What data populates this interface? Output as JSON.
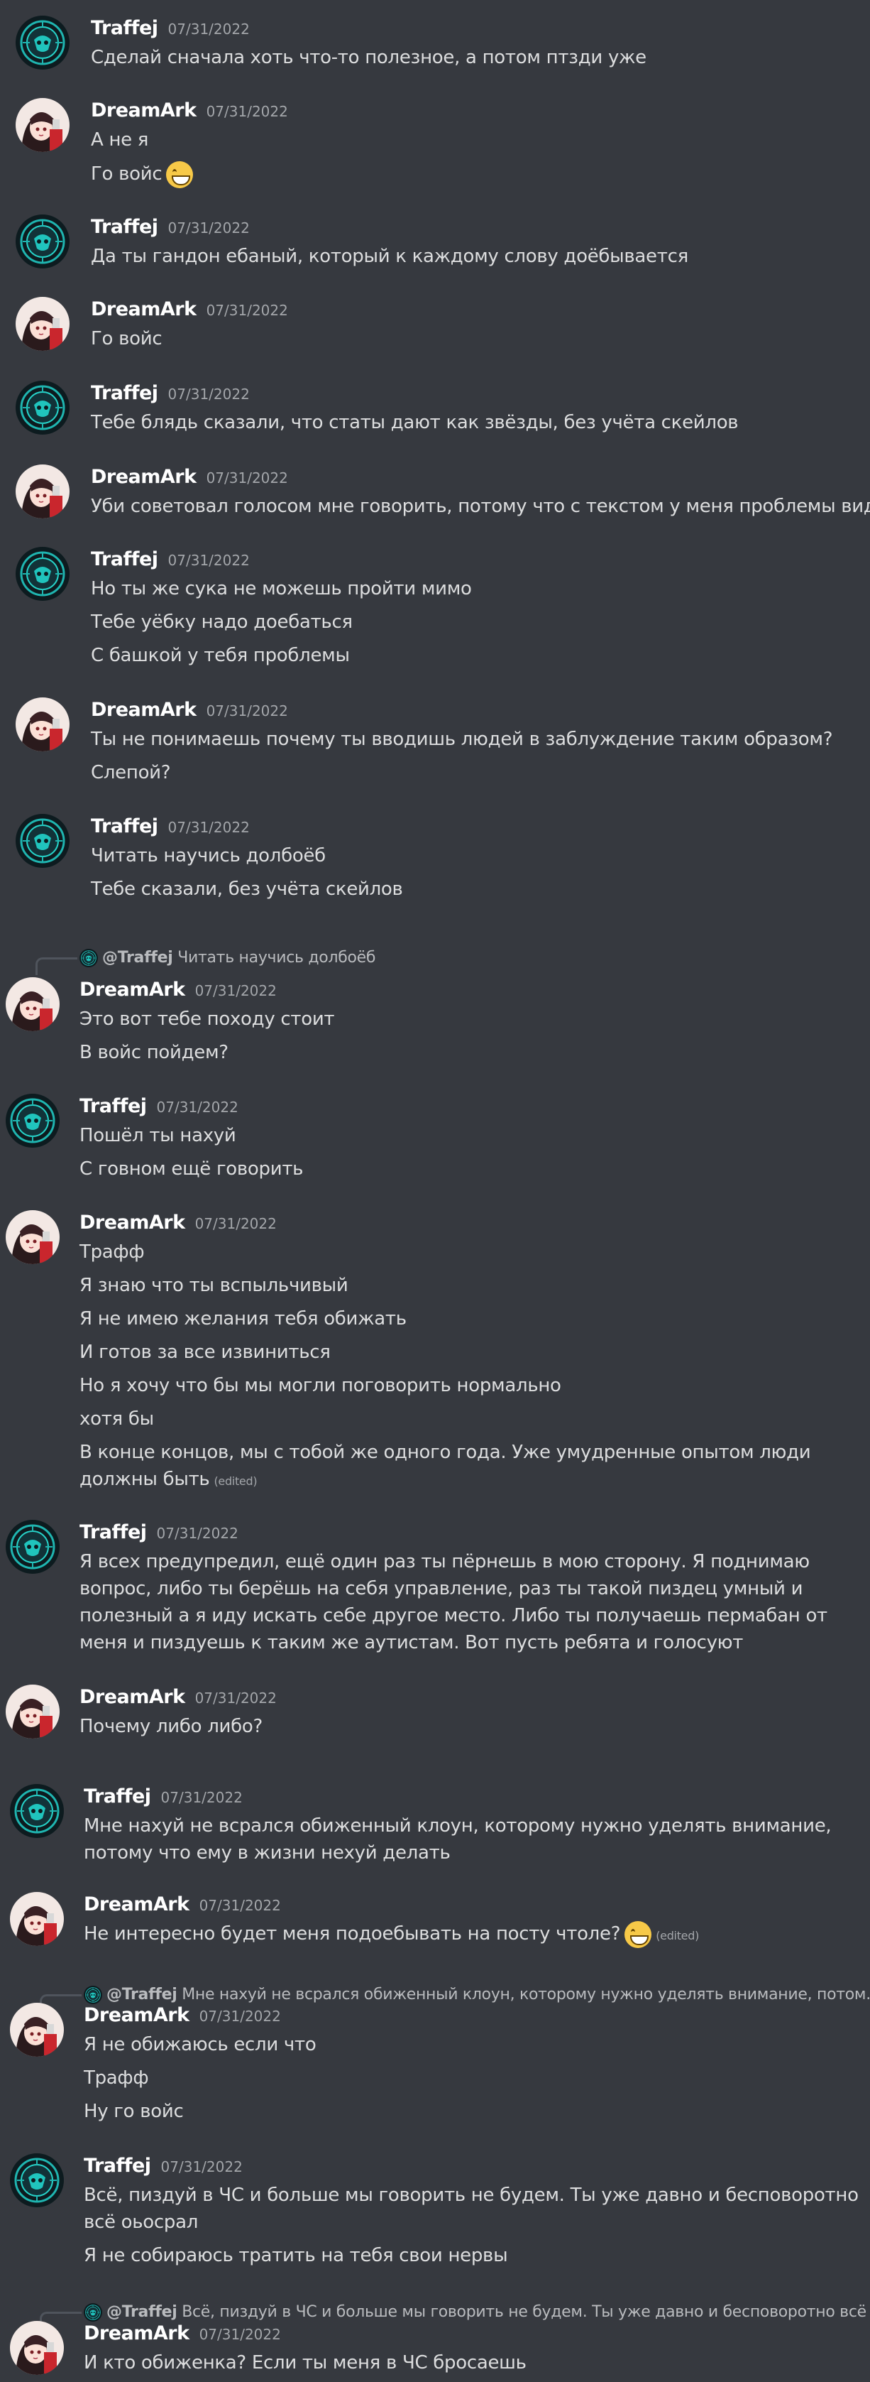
{
  "messages": [
    {
      "author": "Traffej",
      "time": "07/31/2022",
      "lines": [
        "Сделай сначала хоть что-то полезное, а потом птзди уже"
      ]
    },
    {
      "author": "DreamArk",
      "time": "07/31/2022",
      "lines": [
        "А не я",
        "Го войс"
      ]
    },
    {
      "author": "Traffej",
      "time": "07/31/2022",
      "lines": [
        "Да ты гандон ебаный, который к каждому слову доёбывается"
      ]
    },
    {
      "author": "DreamArk",
      "time": "07/31/2022",
      "lines": [
        "Го войс"
      ]
    },
    {
      "author": "Traffej",
      "time": "07/31/2022",
      "lines": [
        "Тебе блядь сказали, что статы дают как звёзды, без учёта скейлов"
      ]
    },
    {
      "author": "DreamArk",
      "time": "07/31/2022",
      "lines": [
        "Уби советовал голосом мне говорить, потому что с текстом у меня проблемы видать"
      ]
    },
    {
      "author": "Traffej",
      "time": "07/31/2022",
      "lines": [
        "Но ты же сука не можешь пройти мимо",
        "Тебе уёбку надо доебаться",
        "С башкой у тебя проблемы"
      ]
    },
    {
      "author": "DreamArk",
      "time": "07/31/2022",
      "lines": [
        "Ты не понимаешь почему ты вводишь людей в заблуждение таким образом?",
        "Слепой?"
      ]
    },
    {
      "author": "Traffej",
      "time": "07/31/2022",
      "lines": [
        "Читать научись долбоёб",
        "Тебе сказали, без учёта скейлов"
      ]
    },
    {
      "author": "DreamArk",
      "time": "07/31/2022",
      "reply": {
        "name": "@Traffej",
        "text": "Читать научись долбоёб"
      },
      "lines": [
        "Это вот тебе походу стоит",
        "В войс пойдем?"
      ]
    },
    {
      "author": "Traffej",
      "time": "07/31/2022",
      "lines": [
        "Пошёл ты нахуй",
        "С говном ещё говорить"
      ]
    },
    {
      "author": "DreamArk",
      "time": "07/31/2022",
      "lines": [
        "Трафф",
        "Я знаю что ты вспыльчивый",
        "Я не имею желания тебя обижать",
        "И готов за все извиниться",
        "Но я хочу что бы мы могли поговорить нормально",
        "хотя бы",
        "В конце концов, мы с тобой же одного года. Уже умудренные опытом люди должны быть"
      ],
      "edited": "(edited)"
    },
    {
      "author": "Traffej",
      "time": "07/31/2022",
      "lines": [
        "Я всех предупредил, ещё один раз ты пёрнешь в мою сторону. Я поднимаю вопрос, либо ты берёшь на себя управление, раз ты такой пиздец умный и полезный а я иду искать себе другое место. Либо ты получаешь пермабан от меня и пиздуешь к таким же аутистам. Вот пусть ребята и голосуют"
      ]
    },
    {
      "author": "DreamArk",
      "time": "07/31/2022",
      "lines": [
        "Почему либо либо?"
      ]
    },
    {
      "author": "Traffej",
      "time": "07/31/2022",
      "lines": [
        "Мне нахуй не всрался обиженный клоун, которому нужно уделять внимание, потому что ему в жизни нехуй делать"
      ]
    },
    {
      "author": "DreamArk",
      "time": "07/31/2022",
      "lines": [
        "Не интересно будет меня подоебывать на посту чтоле?"
      ],
      "edited": "(edited)"
    },
    {
      "author": "DreamArk",
      "time": "07/31/2022",
      "reply": {
        "name": "@Traffej",
        "text": "Мне нахуй не всрался обиженный клоун, которому нужно уделять внимание, потом..."
      },
      "lines": [
        "Я не обижаюсь если что",
        "Трафф",
        "Ну го войс"
      ]
    },
    {
      "author": "Traffej",
      "time": "07/31/2022",
      "lines": [
        "Всё, пиздуй в ЧС и больше мы говорить не будем. Ты уже давно и бесповоротно всё оьосрал",
        "Я не собираюсь тратить на тебя свои нервы"
      ]
    },
    {
      "author": "DreamArk",
      "time": "07/31/2022",
      "reply": {
        "name": "@Traffej",
        "text": "Всё, пиздуй в ЧС и больше мы говорить не будем. Ты уже давно и бесповоротно всё ..."
      },
      "lines": [
        "И кто обиженка? Если ты меня в ЧС бросаешь"
      ]
    }
  ]
}
